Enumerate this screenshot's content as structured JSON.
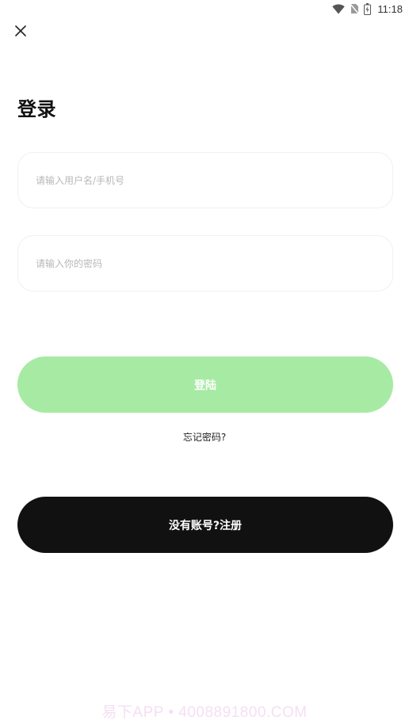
{
  "status_bar": {
    "time": "11:18",
    "icons": [
      "wifi-icon",
      "no-sim-icon",
      "battery-icon"
    ]
  },
  "header": {
    "close_icon": "close-icon"
  },
  "page": {
    "title": "登录"
  },
  "form": {
    "username_placeholder": "请输入用户名/手机号",
    "username_value": "",
    "password_placeholder": "请输入你的密码",
    "password_value": ""
  },
  "actions": {
    "login_label": "登陆",
    "forgot_label": "忘记密码?",
    "register_label": "没有账号?注册"
  },
  "watermark": {
    "text": "易下APP • 4008891800.COM"
  },
  "colors": {
    "login_button_bg": "#a7eaa4",
    "register_button_bg": "#111111",
    "title": "#111111",
    "placeholder": "#b8b8b8"
  }
}
